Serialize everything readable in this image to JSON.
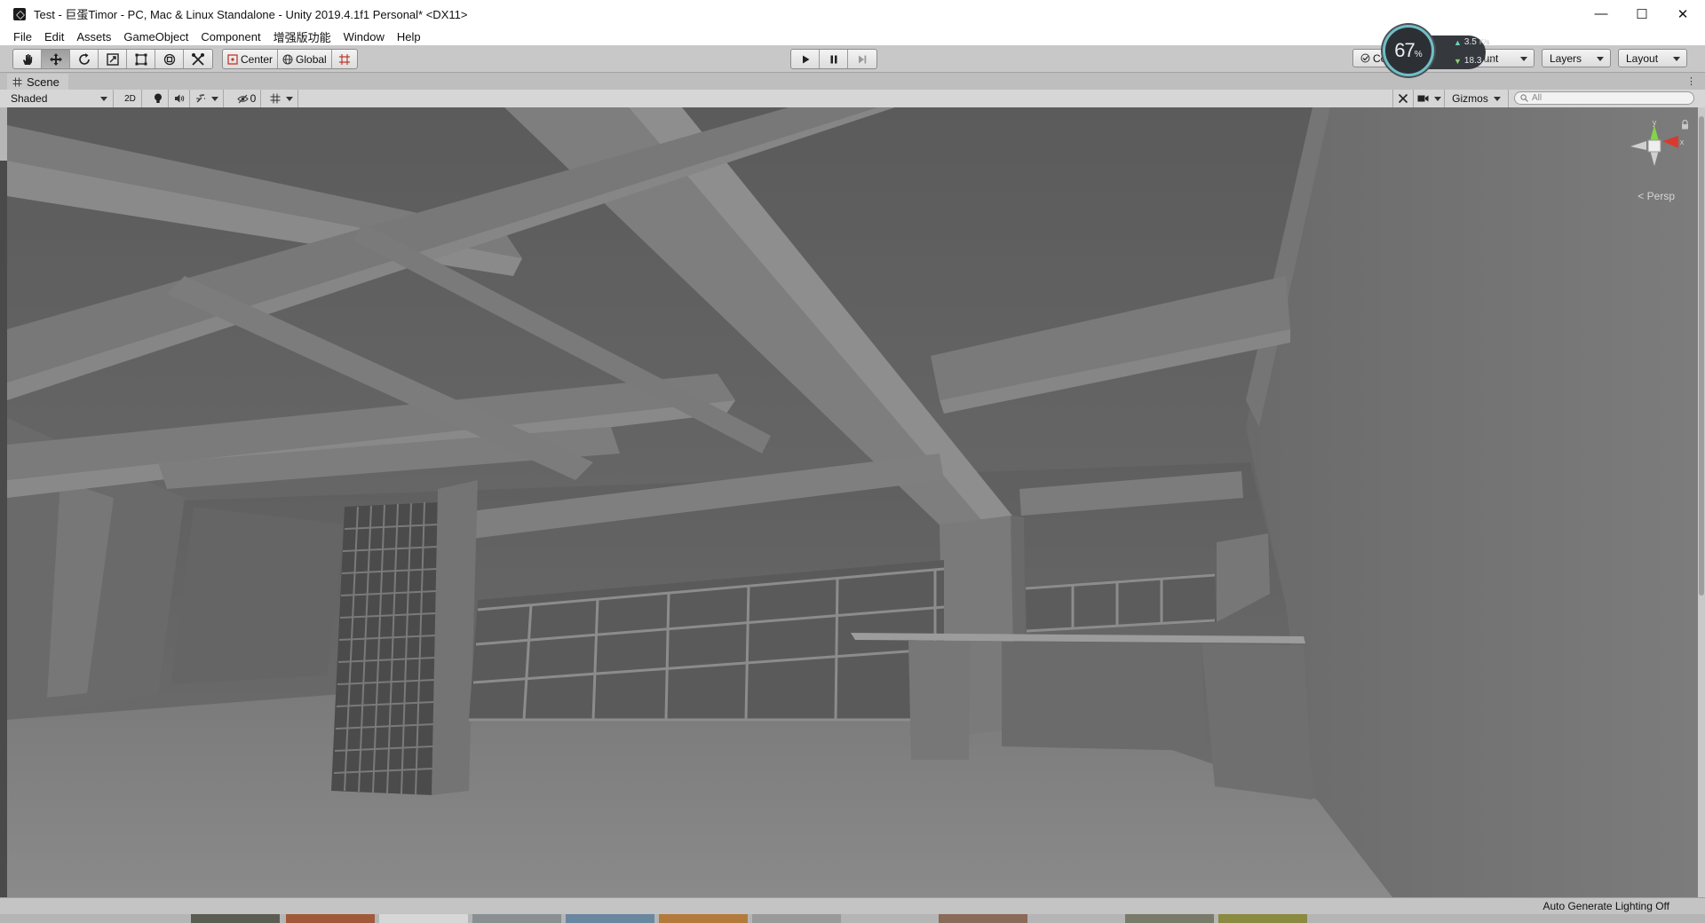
{
  "window": {
    "title": "Test - 巨蛋Timor - PC, Mac & Linux Standalone - Unity 2019.4.1f1 Personal* <DX11>",
    "minimize": "—",
    "maximize": "☐",
    "close": "✕"
  },
  "menu": {
    "items": [
      "File",
      "Edit",
      "Assets",
      "GameObject",
      "Component",
      "增强版功能",
      "Window",
      "Help"
    ]
  },
  "toolbar": {
    "tools": [
      "hand-tool-icon",
      "move-tool-icon",
      "rotate-tool-icon",
      "scale-tool-icon",
      "rect-tool-icon",
      "transform-tool-icon",
      "custom-tool-icon"
    ],
    "active_tool": "move-tool-icon",
    "pivot_label": "Center",
    "space_label": "Global",
    "collab_label": "Co",
    "account_label": "ount",
    "layers_label": "Layers",
    "layout_label": "Layout"
  },
  "perf": {
    "percent": "67",
    "percent_sign": "%",
    "up_speed": "3.5",
    "up_unit": "K/s",
    "down_speed": "18.3",
    "down_unit": "K/s"
  },
  "scene_tab": {
    "label": "Scene"
  },
  "scene_toolbar": {
    "draw_mode": "Shaded",
    "mode_2d": "2D",
    "hidden_count": "0",
    "gizmos_label": "Gizmos",
    "search_placeholder": "All"
  },
  "gizmo": {
    "y_label": "y",
    "x_label": "x",
    "projection": "Persp"
  },
  "status": {
    "text": "Auto Generate Lighting Off"
  },
  "colors": {
    "gizmo_y": "#86d24a",
    "gizmo_x": "#d93a2e",
    "perf_ring": "#6fc0c6"
  }
}
